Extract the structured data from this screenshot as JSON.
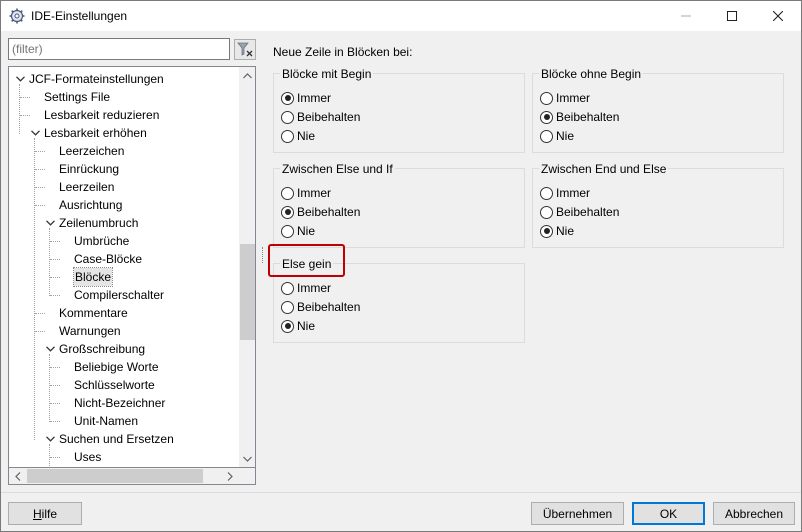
{
  "window": {
    "title": "IDE-Einstellungen"
  },
  "filter": {
    "placeholder": "(filter)"
  },
  "tree": {
    "items": [
      {
        "label": "JCF-Formateinstellungen",
        "level": 0,
        "expanded": true
      },
      {
        "label": "Settings File",
        "level": 1
      },
      {
        "label": "Lesbarkeit reduzieren",
        "level": 1
      },
      {
        "label": "Lesbarkeit erhöhen",
        "level": 1,
        "expanded": true
      },
      {
        "label": "Leerzeichen",
        "level": 2
      },
      {
        "label": "Einrückung",
        "level": 2
      },
      {
        "label": "Leerzeilen",
        "level": 2
      },
      {
        "label": "Ausrichtung",
        "level": 2
      },
      {
        "label": "Zeilenumbruch",
        "level": 2,
        "expanded": true
      },
      {
        "label": "Umbrüche",
        "level": 3
      },
      {
        "label": "Case-Blöcke",
        "level": 3
      },
      {
        "label": "Blöcke",
        "level": 3,
        "selected": true
      },
      {
        "label": "Compilerschalter",
        "level": 3
      },
      {
        "label": "Kommentare",
        "level": 2
      },
      {
        "label": "Warnungen",
        "level": 2
      },
      {
        "label": "Großschreibung",
        "level": 2,
        "expanded": true
      },
      {
        "label": "Beliebige Worte",
        "level": 3
      },
      {
        "label": "Schlüsselworte",
        "level": 3
      },
      {
        "label": "Nicht-Bezeichner",
        "level": 3
      },
      {
        "label": "Unit-Namen",
        "level": 3
      },
      {
        "label": "Suchen und Ersetzen",
        "level": 2,
        "expanded": true
      },
      {
        "label": "Uses",
        "level": 3
      }
    ]
  },
  "main": {
    "heading": "Neue Zeile in Blöcken bei:",
    "groups": [
      {
        "title": "Blöcke mit Begin",
        "options": [
          "Immer",
          "Beibehalten",
          "Nie"
        ],
        "selected": 0
      },
      {
        "title": "Blöcke ohne Begin",
        "options": [
          "Immer",
          "Beibehalten",
          "Nie"
        ],
        "selected": 1
      },
      {
        "title": "Zwischen Else und If",
        "options": [
          "Immer",
          "Beibehalten",
          "Nie"
        ],
        "selected": 1
      },
      {
        "title": "Zwischen End und Else",
        "options": [
          "Immer",
          "Beibehalten",
          "Nie"
        ],
        "selected": 2
      },
      {
        "title": "Else gein",
        "options": [
          "Immer",
          "Beibehalten",
          "Nie"
        ],
        "selected": 2
      }
    ]
  },
  "buttons": {
    "help": "Hilfe",
    "apply": "Übernehmen",
    "ok": "OK",
    "cancel": "Abbrechen"
  },
  "colors": {
    "highlight": "#c00000",
    "accent": "#0078d7"
  }
}
